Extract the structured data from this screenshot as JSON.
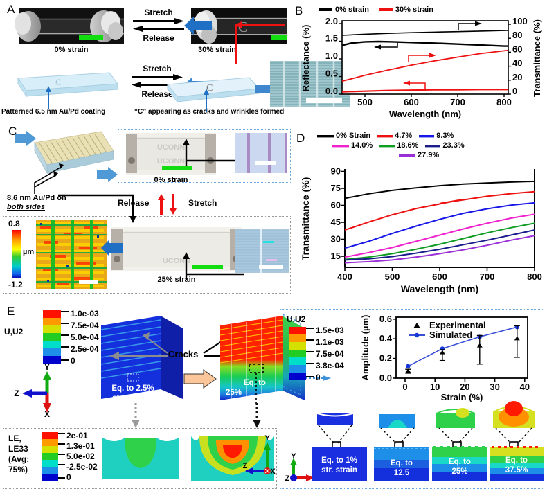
{
  "panels": {
    "A": {
      "letter": "A",
      "stretch": "Stretch",
      "release": "Release",
      "caption_left": "0% strain",
      "caption_right": "30% strain",
      "schematic_left_label": "Patterned 6.5 nm Au/Pd coating",
      "schematic_right_label": "“C” appearing as cracks and wrinkles formed",
      "letter_c_on_film": "C"
    },
    "B": {
      "letter": "B",
      "legend": [
        {
          "label": "0% strain",
          "color": "#000000"
        },
        {
          "label": "30% strain",
          "color": "#ee1111"
        }
      ]
    },
    "C": {
      "letter": "C",
      "coating_label_line1": "8.6 nm Au/Pd on",
      "coating_label_line2": "both sides",
      "release": "Release",
      "stretch": "Stretch",
      "caption_top": "0% strain",
      "caption_bottom": "25% strain",
      "sample_text": "UCONN",
      "afm_max": "0.8",
      "afm_min": "-1.2",
      "afm_unit": "µm"
    },
    "D": {
      "letter": "D",
      "legend": [
        {
          "label": "0% Strain",
          "color": "#000000"
        },
        {
          "label": "4.7%",
          "color": "#ee1111"
        },
        {
          "label": "9.3%",
          "color": "#1717e8"
        },
        {
          "label": "14.0%",
          "color": "#ee22cc"
        },
        {
          "label": "18.6%",
          "color": "#0f9c22"
        },
        {
          "label": "23.3%",
          "color": "#1b1b8c"
        },
        {
          "label": "27.9%",
          "color": "#9b2fd6"
        }
      ]
    },
    "E": {
      "letter": "E",
      "colorbar1_title": "U,U2",
      "colorbar1_ticks": [
        "1.0e-03",
        "7.5e-04",
        "5.0e-04",
        "2.5e-04",
        "0"
      ],
      "colorbar2_title": "U,U2",
      "colorbar2_ticks": [
        "1.5e-03",
        "1.1e-03",
        "7.5e-04",
        "3.8e-04",
        "0"
      ],
      "cracks_label": "Cracks",
      "block_left_line1": "Eq. to 2.5%",
      "block_left_line2": "str. strain",
      "block_right_line1": "Eq. to",
      "block_right_line2": "25%",
      "axes_top": {
        "x": "X",
        "y": "Y",
        "z": "Z"
      },
      "le_title_lines": [
        "LE,",
        "LE33",
        "(Avg:",
        "75%)"
      ],
      "le_ticks": [
        "2e-01",
        "1.3e-01",
        "5.0e-02",
        "-2.5e-02",
        "0"
      ],
      "axes_mid": {
        "x": "X",
        "y": "Y",
        "z": "Z"
      },
      "axes_bottom": {
        "x": "X",
        "y": "Y",
        "z": "Z"
      },
      "sim_panels": [
        {
          "line1": "Eq. to 1%",
          "line2": "str. strain"
        },
        {
          "line1": "Eq. to",
          "line2": "12.5"
        },
        {
          "line1": "Eq. to",
          "line2": "25%"
        },
        {
          "line1": "Eq. to",
          "line2": "37.5%"
        }
      ]
    }
  },
  "chart_data": [
    {
      "id": "panelB",
      "type": "line",
      "title": "",
      "xlabel": "Wavelength (nm)",
      "ylabel": "Reflectance (%)",
      "y2label": "Transmittance (%)",
      "xlim": [
        450,
        810
      ],
      "ylim": [
        0.0,
        2.2
      ],
      "y2lim": [
        0,
        105
      ],
      "xticks": [
        500,
        600,
        700,
        800
      ],
      "yticks": [
        0.0,
        0.5,
        1.0,
        1.5,
        2.0
      ],
      "y2ticks": [
        0,
        20,
        40,
        60,
        80,
        100
      ],
      "grid": false,
      "legend_position": "top",
      "series": [
        {
          "name": "0% strain transmittance",
          "color": "#000000",
          "axis": "right",
          "x": [
            450,
            500,
            550,
            600,
            650,
            700,
            750,
            800,
            810
          ],
          "values": [
            84.0,
            85.6,
            86.8,
            87.8,
            88.6,
            89.3,
            90.1,
            90.9,
            91.0
          ]
        },
        {
          "name": "0% strain reflectance",
          "color": "#000000",
          "axis": "left",
          "x": [
            450,
            470,
            500,
            530,
            560,
            600,
            650,
            700,
            750,
            800,
            810
          ],
          "values": [
            1.46,
            1.53,
            1.57,
            1.58,
            1.57,
            1.55,
            1.53,
            1.5,
            1.47,
            1.44,
            1.44
          ]
        },
        {
          "name": "30% strain transmittance",
          "color": "#ee1111",
          "axis": "right",
          "x": [
            450,
            500,
            550,
            600,
            650,
            700,
            750,
            800,
            810
          ],
          "values": [
            18.5,
            27.0,
            34.5,
            41.5,
            47.5,
            53.0,
            58.0,
            62.0,
            62.5
          ]
        },
        {
          "name": "30% strain reflectance",
          "color": "#ee1111",
          "axis": "left",
          "x": [
            450,
            500,
            550,
            600,
            650,
            700,
            750,
            800,
            810
          ],
          "values": [
            0.07,
            0.09,
            0.11,
            0.12,
            0.13,
            0.13,
            0.14,
            0.14,
            0.14
          ]
        }
      ],
      "annotations": [
        {
          "text": "arrow-right-black-top",
          "meaning": "right axis"
        },
        {
          "text": "arrow-left-black-mid",
          "meaning": "left axis"
        },
        {
          "text": "arrow-right-red-mid",
          "meaning": "right axis"
        },
        {
          "text": "arrow-left-red-bottom",
          "meaning": "left axis"
        }
      ]
    },
    {
      "id": "panelD",
      "type": "line",
      "title": "",
      "xlabel": "Wavelength (nm)",
      "ylabel": "Transmittance (%)",
      "xlim": [
        400,
        800
      ],
      "ylim": [
        8,
        95
      ],
      "xticks": [
        400,
        500,
        600,
        700,
        800
      ],
      "yticks": [
        15,
        30,
        45,
        60,
        75,
        90
      ],
      "grid": false,
      "legend_position": "top",
      "x": [
        400,
        450,
        500,
        550,
        600,
        650,
        700,
        750,
        800
      ],
      "series": [
        {
          "name": "0% Strain",
          "color": "#000000",
          "values": [
            69.0,
            73.0,
            76.0,
            78.3,
            80.2,
            81.6,
            82.6,
            83.4,
            84.0
          ]
        },
        {
          "name": "4.7%",
          "color": "#ee1111",
          "values": [
            41.0,
            48.0,
            54.5,
            60.0,
            64.5,
            68.2,
            71.0,
            73.3,
            75.0
          ]
        },
        {
          "name": "9.3%",
          "color": "#1717e8",
          "values": [
            25.0,
            31.0,
            38.0,
            44.5,
            50.5,
            55.8,
            59.8,
            63.0,
            65.0
          ]
        },
        {
          "name": "14.0%",
          "color": "#ee22cc",
          "values": [
            17.0,
            21.0,
            25.5,
            31.0,
            36.5,
            42.0,
            47.0,
            51.5,
            55.0
          ]
        },
        {
          "name": "18.6%",
          "color": "#0f9c22",
          "values": [
            15.0,
            17.0,
            20.0,
            24.0,
            28.5,
            33.5,
            38.5,
            43.0,
            47.0
          ]
        },
        {
          "name": "23.3%",
          "color": "#1b1b8c",
          "values": [
            14.5,
            15.5,
            17.5,
            20.5,
            24.0,
            28.0,
            32.0,
            36.5,
            41.0
          ]
        },
        {
          "name": "27.9%",
          "color": "#9b2fd6",
          "values": [
            12.0,
            13.0,
            14.5,
            17.0,
            20.0,
            23.5,
            27.5,
            32.0,
            36.0
          ]
        }
      ]
    },
    {
      "id": "panelE_amplitude",
      "type": "scatter",
      "title": "",
      "xlabel": "Strain (%)",
      "ylabel": "Amplitude (µm)",
      "xlim": [
        -3,
        41
      ],
      "ylim": [
        0.0,
        0.62
      ],
      "xticks": [
        0,
        10,
        20,
        30,
        40
      ],
      "yticks": [
        0.0,
        0.2,
        0.4,
        0.6
      ],
      "grid": false,
      "legend_position": "inside-top-left",
      "series": [
        {
          "name": "Experimental",
          "color": "#000000",
          "marker": "triangle",
          "x": [
            1.0,
            12.5,
            25.0,
            37.5
          ],
          "values": [
            0.07,
            0.26,
            0.36,
            0.43
          ],
          "yerr": [
            0.02,
            0.055,
            0.075,
            0.09
          ]
        },
        {
          "name": "Simulated",
          "color": "#2b3fd0",
          "marker": "circle-line",
          "x": [
            1.0,
            12.5,
            25.0,
            37.5
          ],
          "values": [
            0.12,
            0.3,
            0.42,
            0.52
          ],
          "yerr": [
            0.0,
            0.02,
            0.02,
            0.02
          ]
        }
      ]
    }
  ]
}
